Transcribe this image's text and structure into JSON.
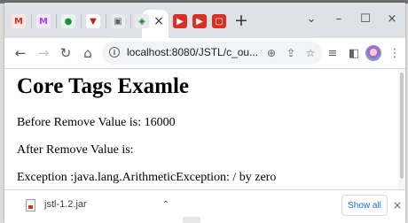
{
  "browser": {
    "tabs": [
      {
        "icon": "M",
        "color": "#d93025",
        "bg": "#fde7e4"
      },
      {
        "icon": "M",
        "color": "#a142f4",
        "bg": "#f1e6fe"
      },
      {
        "icon": "●",
        "color": "#1e8e3e",
        "bg": "#e6f4ea"
      },
      {
        "icon": "▼",
        "color": "#c5221f",
        "bg": "#ffffff"
      },
      {
        "icon": "▣",
        "color": "#5f6368",
        "bg": "#e8eaed"
      },
      {
        "icon": "◈",
        "color": "#188038",
        "bg": "#e8eaed"
      }
    ],
    "active_tab_close": "×",
    "trailing_tabs": [
      {
        "icon": "▶",
        "color": "#ffffff",
        "bg": "#d93025"
      },
      {
        "icon": "▶",
        "color": "#ffffff",
        "bg": "#d93025"
      },
      {
        "icon": "▢",
        "color": "#ffffff",
        "bg": "#d93025"
      }
    ],
    "new_tab": "+",
    "window_controls": {
      "dropdown": "⌄",
      "minimize": "–",
      "maximize": "☐",
      "close": "×"
    },
    "toolbar": {
      "back": "←",
      "forward": "→",
      "reload": "↻",
      "home": "⌂",
      "url": "localhost:8080/JSTL/c_ou...",
      "zoom_icon": "⊕",
      "share_icon": "⇪",
      "star_icon": "☆",
      "queue_icon": "≡",
      "sidepanel_icon": "◧",
      "menu_icon": "⋮"
    }
  },
  "page": {
    "heading": "Core Tags Examle",
    "line1": "Before Remove Value is: 16000",
    "line2": "After Remove Value is:",
    "line3": "Exception :java.lang.ArithmeticException: / by zero"
  },
  "downloads": {
    "file_name": "jstl-1.2.jar",
    "chevron": "⌃",
    "show_all": "Show all",
    "close": "×"
  }
}
